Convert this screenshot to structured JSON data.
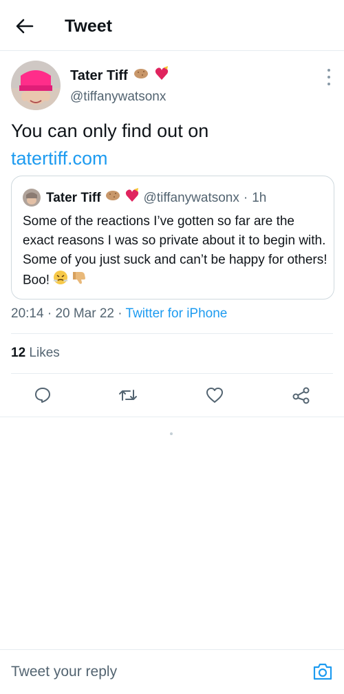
{
  "header": {
    "title": "Tweet",
    "back_icon": "arrow-left-icon"
  },
  "tweet": {
    "author": {
      "name": "Tater Tiff",
      "handle": "@tiffanywatsonx",
      "name_emojis": [
        "potato-emoji",
        "heart-with-ribbon-emoji"
      ]
    },
    "text": "You can only find out on",
    "link": "tatertiff.com",
    "time": "20:14",
    "date": "20 Mar 22",
    "separator": "·",
    "source": "Twitter for iPhone",
    "likes_count": "12",
    "likes_label": "Likes"
  },
  "quoted_tweet": {
    "name": "Tater Tiff",
    "handle": "@tiffanywatsonx",
    "separator": "·",
    "time": "1h",
    "text": "Some of the reactions I’ve gotten so far are the exact reasons I was so private about it to begin with. Some of you just suck and can’t be happy for others! Boo!",
    "trailing_emojis": [
      "face-with-steam-emoji",
      "thumbs-down-emoji"
    ]
  },
  "actions": [
    {
      "name": "reply-icon"
    },
    {
      "name": "retweet-icon"
    },
    {
      "name": "like-icon"
    },
    {
      "name": "share-icon"
    }
  ],
  "reply_bar": {
    "placeholder": "Tweet your reply",
    "camera_icon": "camera-icon"
  },
  "colors": {
    "accent": "#1d9bf0",
    "secondary_text": "#536471",
    "border": "#e6ecf0"
  }
}
